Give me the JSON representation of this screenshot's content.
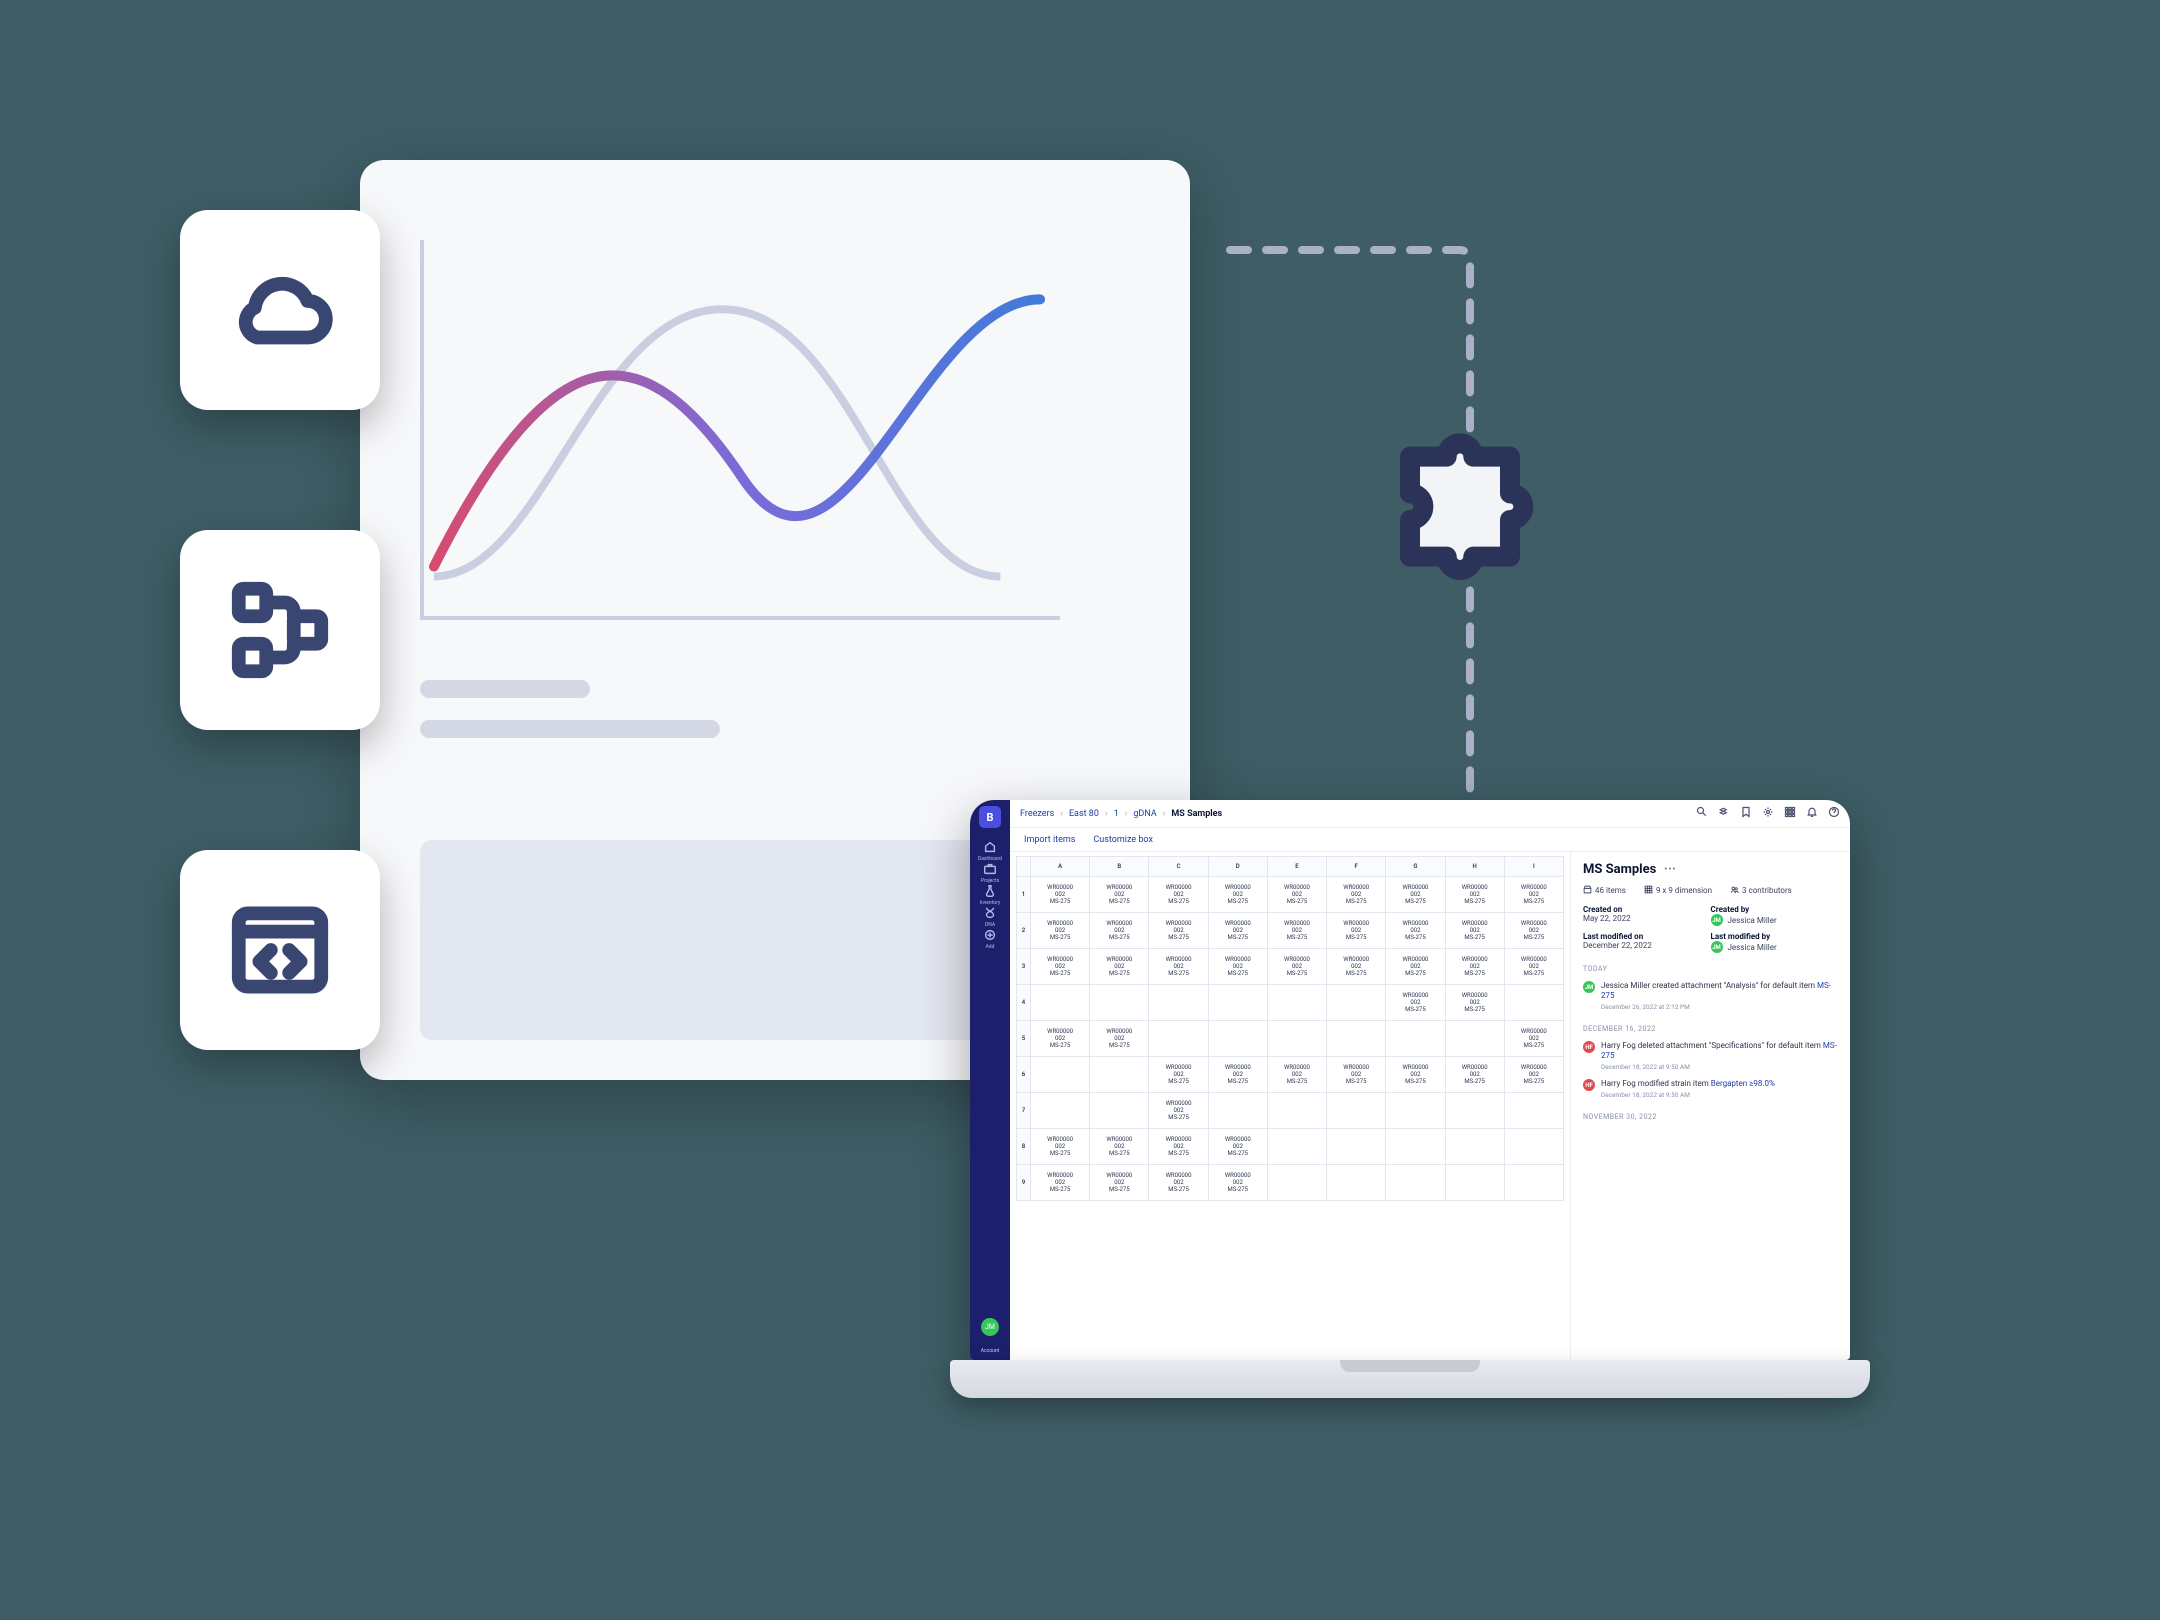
{
  "tiles": {
    "cloud": "cloud-icon",
    "workflow": "workflow-icon",
    "code": "code-icon"
  },
  "puzzle": "puzzle-icon",
  "app": {
    "logo": "B",
    "sidebar": {
      "items": [
        {
          "icon": "home-icon",
          "label": "Dashboard"
        },
        {
          "icon": "briefcase-icon",
          "label": "Projects"
        },
        {
          "icon": "flask-icon",
          "label": "Inventory"
        },
        {
          "icon": "dna-icon",
          "label": "DNA"
        },
        {
          "icon": "plus-icon",
          "label": "Add"
        }
      ],
      "account_label": "Account",
      "account_initials": "JM"
    },
    "topbar_icons": [
      "search-icon",
      "dropbox-icon",
      "bookmark-icon",
      "gear-icon",
      "apps-icon",
      "bell-icon",
      "help-icon"
    ],
    "breadcrumb": [
      "Freezers",
      "East 80",
      "1",
      "gDNA",
      "MS Samples"
    ],
    "toolbar": {
      "import": "Import items",
      "customize": "Customize box"
    },
    "grid": {
      "columns": [
        "A",
        "B",
        "C",
        "D",
        "E",
        "F",
        "G",
        "H",
        "I"
      ],
      "rows": [
        "1",
        "2",
        "3",
        "4",
        "5",
        "6",
        "7",
        "8",
        "9"
      ],
      "cell_line1": "WR00000",
      "cell_line2": "002",
      "cell_line3": "MS-275",
      "filled": {
        "1": [
          0,
          1,
          2,
          3,
          4,
          5,
          6,
          7,
          8
        ],
        "2": [
          0,
          1,
          2,
          3,
          4,
          5,
          6,
          7,
          8
        ],
        "3": [
          0,
          1,
          2,
          3,
          4,
          5,
          6,
          7,
          8
        ],
        "4": [
          6,
          7
        ],
        "5": [
          0,
          1,
          8
        ],
        "6": [
          2,
          3,
          4,
          5,
          6,
          7,
          8
        ],
        "7": [
          2
        ],
        "8": [
          0,
          1,
          2,
          3
        ],
        "9": [
          0,
          1,
          2,
          3
        ]
      }
    },
    "details": {
      "title": "MS Samples",
      "stats": {
        "items": "46 items",
        "dimension": "9 x 9 dimension",
        "contributors": "3 contributors"
      },
      "created_on_label": "Created on",
      "created_on": "May 22, 2022",
      "created_by_label": "Created by",
      "created_by": "Jessica Miller",
      "modified_on_label": "Last modified on",
      "modified_on": "December 22, 2022",
      "modified_by_label": "Last modified by",
      "modified_by": "Jessica Miller",
      "activity": {
        "sections": [
          {
            "label": "TODAY",
            "items": [
              {
                "avatar_class": "av-green",
                "avatar_initials": "JM",
                "text_prefix": "Jessica Miller created attachment \"Analysis\" for default item ",
                "link": "MS-275",
                "timestamp": "December 26, 2022 at 2:12 PM"
              }
            ]
          },
          {
            "label": "DECEMBER 16, 2022",
            "items": [
              {
                "avatar_class": "av-red",
                "avatar_initials": "HF",
                "text_prefix": "Harry Fog deleted attachment \"Specifications\" for default item ",
                "link": "MS-275",
                "timestamp": "December 18, 2022 at 9:50 AM"
              },
              {
                "avatar_class": "av-red",
                "avatar_initials": "HF",
                "text_prefix": "Harry Fog modified strain item ",
                "link": "Bergapten ≥98.0%",
                "timestamp": "December 18, 2022 at 9:50 AM"
              }
            ]
          },
          {
            "label": "NOVEMBER 30, 2022",
            "items": []
          }
        ]
      }
    }
  }
}
